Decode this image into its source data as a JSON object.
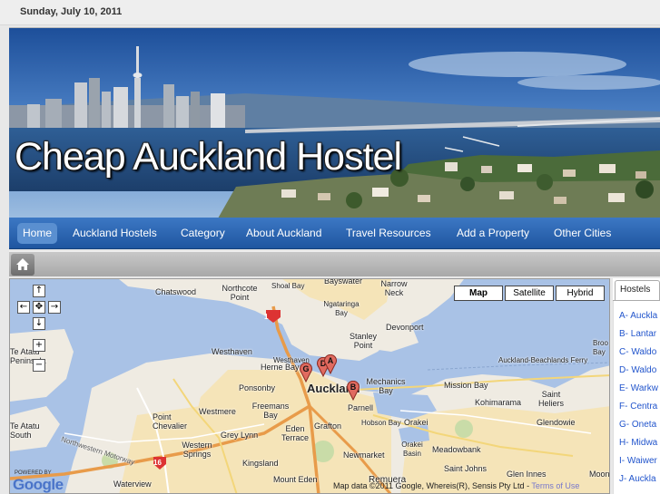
{
  "date": "Sunday, July 10, 2011",
  "site_title": "Cheap Auckland Hostel",
  "nav": {
    "items": [
      "Home",
      "Auckland Hostels",
      "Category",
      "About Auckland",
      "Travel Resources",
      "Add a Property",
      "Other Cities"
    ],
    "active_index": 0
  },
  "map": {
    "types": [
      "Map",
      "Satellite",
      "Hybrid"
    ],
    "selected_type": "Map",
    "controls": {
      "up": "↑",
      "left": "←",
      "center": "✥",
      "right": "→",
      "down": "↓",
      "zoom_in": "+",
      "zoom_out": "−"
    },
    "labels": [
      "Chatswood",
      "Northcote Point",
      "Shoal Bay",
      "Bayswater",
      "Narrow Neck",
      "Ngataringa Bay",
      "Devonport",
      "Stanley Point",
      "Westhaven",
      "Westhaven",
      "Te Atatu Peninsula",
      "Herne Bay",
      "Ponsonby",
      "Freemans Bay",
      "Westmere",
      "Point Chevalier",
      "Grey Lynn",
      "Eden Terrace",
      "Grafton",
      "Parnell",
      "Hobson Bay",
      "Orakei",
      "Mechanics Bay",
      "Mission Bay",
      "Kohimarama",
      "Saint Heliers",
      "Glendowie",
      "Broo Bay",
      "Auckland-Beachlands Ferry",
      "Te Atatu South",
      "Western Springs",
      "Kingsland",
      "Newmarket",
      "Orakei Basin",
      "Meadowbank",
      "Saint Johns",
      "Glen Innes",
      "Moon",
      "Waterview",
      "Mount Eden",
      "Remuera",
      "Northwestern Motorway",
      "Auckland"
    ],
    "route_shields": [
      "1",
      "16"
    ],
    "markers": [
      "G",
      "D",
      "A",
      "B"
    ],
    "powered_by": "POWERED BY",
    "google": "Google",
    "copyright": "Map data ©2011 Google, Whereis(R), Sensis Pty Ltd - ",
    "terms": "Terms of Use",
    "colors": {
      "water": "#a9c2e6",
      "land": "#efebe2",
      "urban": "#f5e4b8",
      "park": "#c9dca8",
      "motorway": "#e89b4a"
    }
  },
  "sidebar": {
    "tab": "Hostels",
    "items": [
      "A- Auckla",
      "B- Lantar",
      "C- Waldo",
      "D- Waldo",
      "E- Warkw",
      "F- Centra",
      "G- Oneta",
      "H- Midwa",
      "I- Waiwer",
      "J- Auckla"
    ]
  }
}
